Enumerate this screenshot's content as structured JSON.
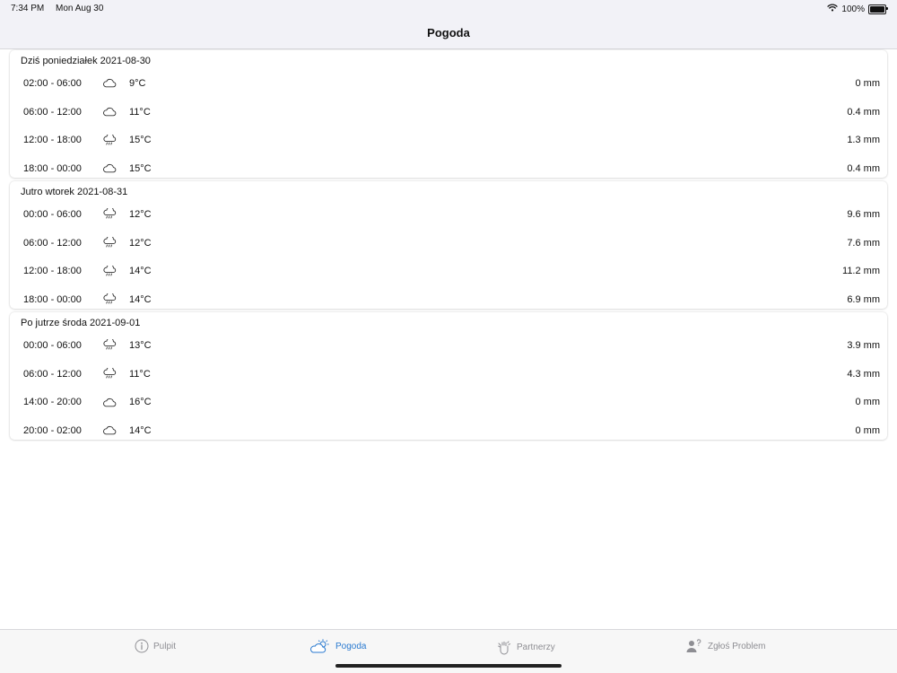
{
  "status": {
    "time": "7:34 PM",
    "date": "Mon Aug 30",
    "battery": "100%",
    "battery_level": 1.0
  },
  "nav": {
    "title": "Pogoda"
  },
  "days": [
    {
      "title": "Dziś poniedziałek 2021-08-30",
      "periods": [
        {
          "time": "02:00 - 06:00",
          "icon": "cloud-icon",
          "temp": "9°C",
          "precip": "0 mm"
        },
        {
          "time": "06:00 - 12:00",
          "icon": "cloud-icon",
          "temp": "11°C",
          "precip": "0.4 mm"
        },
        {
          "time": "12:00 - 18:00",
          "icon": "cloud-rain-icon",
          "temp": "15°C",
          "precip": "1.3 mm"
        },
        {
          "time": "18:00 - 00:00",
          "icon": "cloud-icon",
          "temp": "15°C",
          "precip": "0.4 mm"
        }
      ]
    },
    {
      "title": "Jutro wtorek 2021-08-31",
      "periods": [
        {
          "time": "00:00 - 06:00",
          "icon": "cloud-rain-icon",
          "temp": "12°C",
          "precip": "9.6 mm"
        },
        {
          "time": "06:00 - 12:00",
          "icon": "cloud-rain-icon",
          "temp": "12°C",
          "precip": "7.6 mm"
        },
        {
          "time": "12:00 - 18:00",
          "icon": "cloud-rain-icon",
          "temp": "14°C",
          "precip": "11.2 mm"
        },
        {
          "time": "18:00 - 00:00",
          "icon": "cloud-rain-icon",
          "temp": "14°C",
          "precip": "6.9 mm"
        }
      ]
    },
    {
      "title": "Po jutrze środa 2021-09-01",
      "periods": [
        {
          "time": "00:00 - 06:00",
          "icon": "cloud-rain-icon",
          "temp": "13°C",
          "precip": "3.9 mm"
        },
        {
          "time": "06:00 - 12:00",
          "icon": "cloud-rain-icon",
          "temp": "11°C",
          "precip": "4.3 mm"
        },
        {
          "time": "14:00 - 20:00",
          "icon": "cloud-icon",
          "temp": "16°C",
          "precip": "0 mm"
        },
        {
          "time": "20:00 - 02:00",
          "icon": "cloud-icon",
          "temp": "14°C",
          "precip": "0 mm"
        }
      ]
    }
  ],
  "tabs": [
    {
      "label": "Pulpit",
      "icon": "info-circle-icon",
      "active": false
    },
    {
      "label": "Pogoda",
      "icon": "partly-sunny-icon",
      "active": true
    },
    {
      "label": "Partnerzy",
      "icon": "handshake-icon",
      "active": false
    },
    {
      "label": "Zgłoś Problem",
      "icon": "person-question-icon",
      "active": false
    }
  ],
  "colors": {
    "accent": "#2a7ad0",
    "inactive": "#8e8e93",
    "background": "#f2f2f7"
  }
}
